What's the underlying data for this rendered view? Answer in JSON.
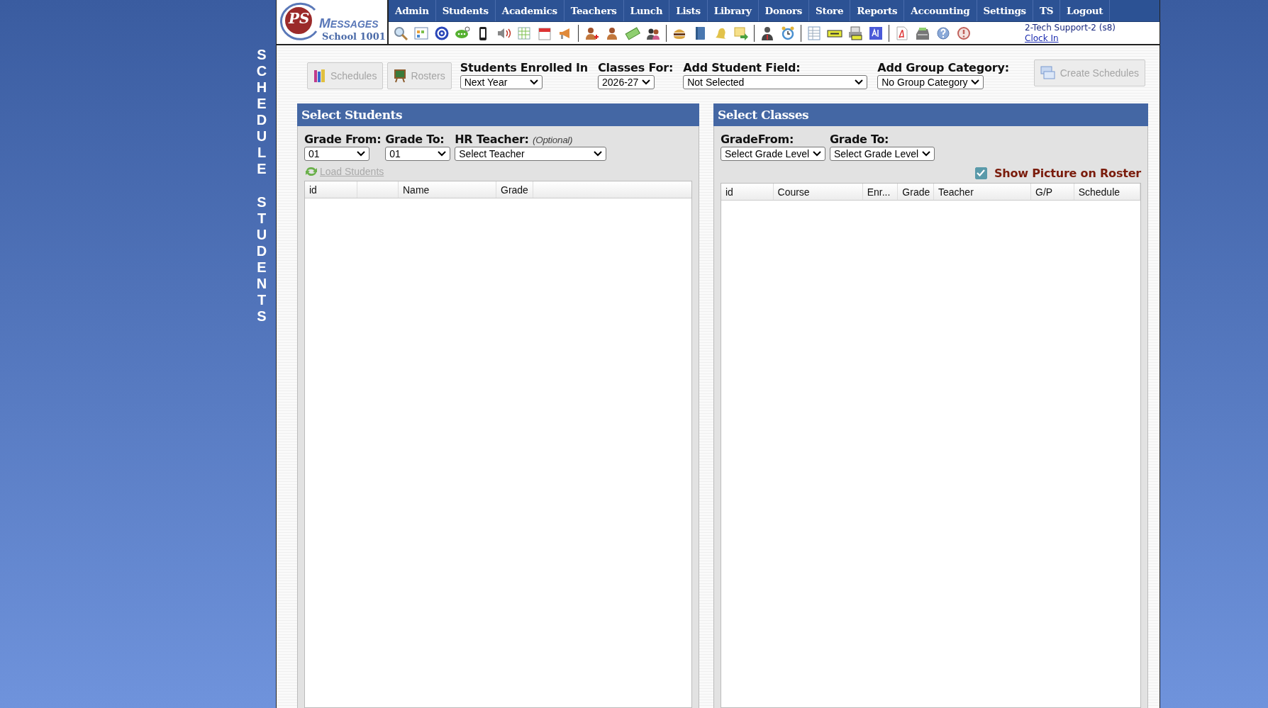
{
  "side_title": [
    "SCHEDULE",
    "STUDENTS"
  ],
  "logo": {
    "mark": "PS",
    "brand": "MESSAGES",
    "school": "School 1001"
  },
  "nav": [
    "Admin",
    "Students",
    "Academics",
    "Teachers",
    "Lunch",
    "Lists",
    "Library",
    "Donors",
    "Store",
    "Reports",
    "Accounting",
    "Settings",
    "TS",
    "Logout"
  ],
  "user": {
    "name": "2-Tech Support-2 (s8)",
    "clock_link": "Clock In"
  },
  "action_buttons": [
    {
      "label": "Schedules",
      "disabled": true
    },
    {
      "label": "Rosters",
      "disabled": true
    }
  ],
  "filters": [
    {
      "label": "Students Enrolled In",
      "value": "Next Year"
    },
    {
      "label": "Classes For:",
      "value": "2026-27"
    },
    {
      "label": "Add Student Field:",
      "value": "Not Selected"
    },
    {
      "label": "Add Group Category:",
      "value": "No Group Category"
    }
  ],
  "create_button": {
    "label": "Create Schedules",
    "disabled": true
  },
  "students_panel": {
    "title": "Select Students",
    "grade_from": {
      "label": "Grade From:",
      "value": "01"
    },
    "grade_to": {
      "label": "Grade To:",
      "value": "01"
    },
    "teacher": {
      "label": "HR Teacher:",
      "hint": "(Optional)",
      "value": "Select Teacher"
    },
    "load_link": {
      "label": "Load Students",
      "disabled": true
    },
    "columns": [
      {
        "kind": "heading",
        "label": "id"
      },
      {
        "kind": "spacer"
      },
      {
        "kind": "heading",
        "label": "Name"
      },
      {
        "kind": "heading",
        "label": "Grade"
      }
    ]
  },
  "classes_panel": {
    "title": "Select Classes",
    "grade_from": {
      "label": "GradeFrom:",
      "value": "Select Grade Level"
    },
    "grade_to": {
      "label": "Grade To:",
      "value": "Select Grade Level"
    },
    "show_picture": {
      "label": "Show Picture on Roster",
      "checked": true
    },
    "columns": [
      {
        "kind": "heading",
        "label": "id"
      },
      {
        "kind": "heading",
        "label": "Course"
      },
      {
        "kind": "heading",
        "label": "Enr..."
      },
      {
        "kind": "heading",
        "label": "Grade"
      },
      {
        "kind": "heading",
        "label": "Teacher"
      },
      {
        "kind": "heading",
        "label": "G/P"
      },
      {
        "kind": "heading",
        "label": "Schedule"
      }
    ]
  }
}
